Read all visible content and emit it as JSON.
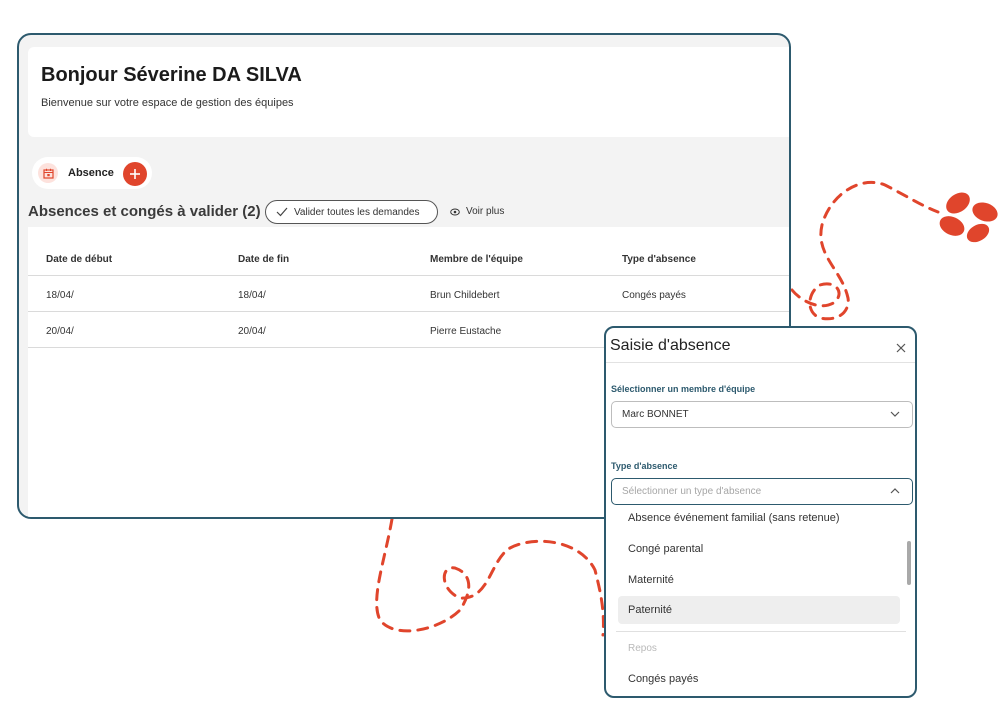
{
  "header": {
    "greeting": "Bonjour Séverine DA SILVA",
    "subtitle": "Bienvenue sur votre espace de gestion des équipes"
  },
  "absence_chip": {
    "label": "Absence",
    "icon": "calendar-icon",
    "add_icon": "plus-icon"
  },
  "section": {
    "title": "Absences et congés à valider (2)",
    "validate_all_label": "Valider toutes les demandes",
    "see_more_label": "Voir plus"
  },
  "table": {
    "columns": [
      "Date de début",
      "Date de fin",
      "Membre de l'équipe",
      "Type d'absence"
    ],
    "rows": [
      [
        "18/04/",
        "18/04/",
        "Brun Childebert",
        "Congés payés"
      ],
      [
        "20/04/",
        "20/04/",
        "Pierre Eustache",
        ""
      ]
    ]
  },
  "modal": {
    "title": "Saisie d'absence",
    "member_label": "Sélectionner un membre d'équipe",
    "member_value": "Marc BONNET",
    "type_label": "Type d'absence",
    "type_placeholder": "Sélectionner un type d'absence",
    "options": [
      "Absence événement familial (sans retenue)",
      "Congé parental",
      "Maternité",
      "Paternité",
      "Repos",
      "Congés payés"
    ],
    "highlighted_option": "Paternité",
    "disabled_option": "Repos"
  },
  "colors": {
    "accent": "#e0452c",
    "frame": "#2d5a6e",
    "background": "#f3f3f3"
  }
}
